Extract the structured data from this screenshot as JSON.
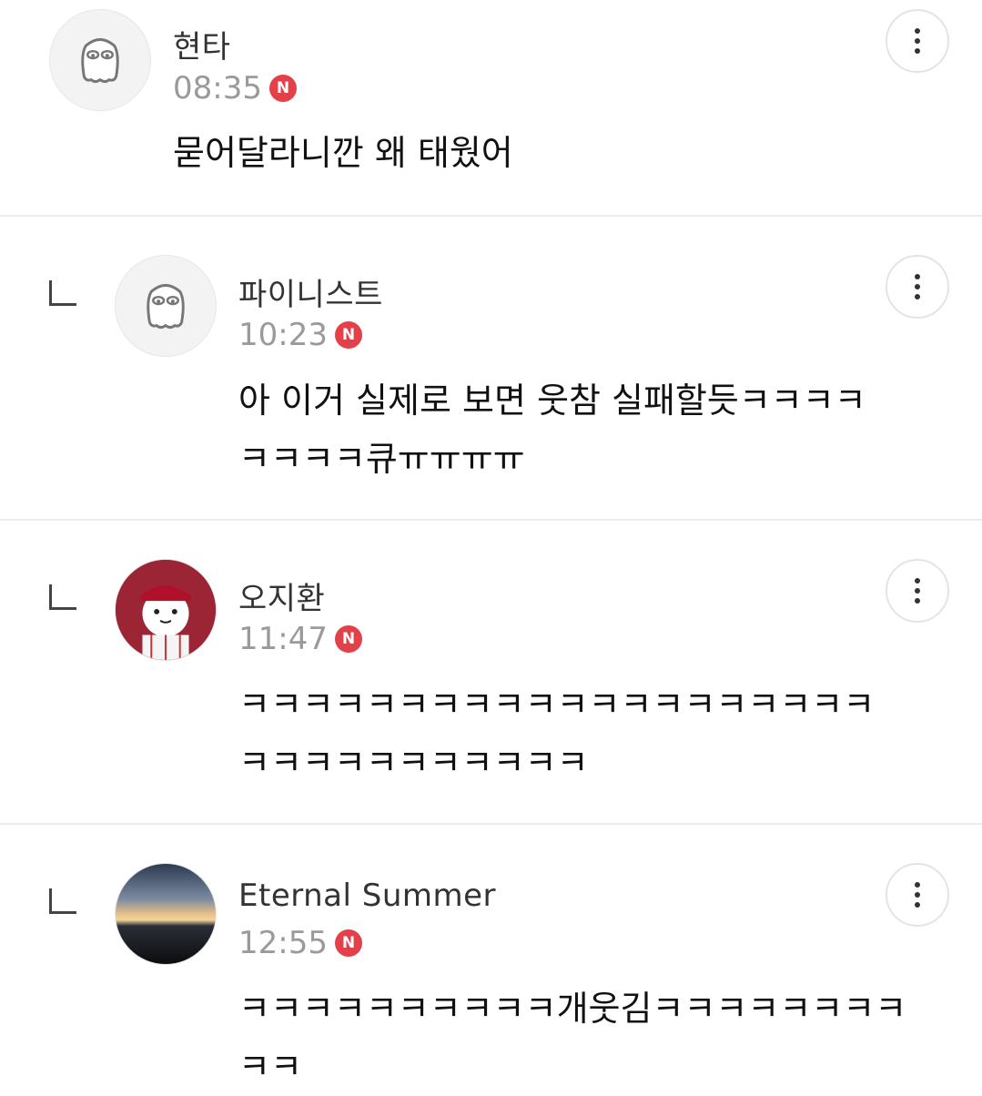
{
  "comments": [
    {
      "author": "현타",
      "time": "08:35",
      "badge": "N",
      "text": "묻어달라니깐 왜 태웠어",
      "avatar": "ghost-avatar",
      "reply": false
    },
    {
      "author": "파이니스트",
      "time": "10:23",
      "badge": "N",
      "text": "아 이거 실제로 보면 웃참 실패할듯ㅋㅋㅋㅋㅋㅋㅋㅋ큐ㅠㅠㅠㅠ",
      "avatar": "ghost-avatar",
      "reply": true
    },
    {
      "author": "오지환",
      "time": "11:47",
      "badge": "N",
      "text": "ㅋㅋㅋㅋㅋㅋㅋㅋㅋㅋㅋㅋㅋㅋㅋㅋㅋㅋㅋㅋㅋㅋㅋㅋㅋㅋㅋㅋㅋㅋㅋ",
      "avatar": "twins-cat-avatar",
      "reply": true
    },
    {
      "author": "Eternal Summer",
      "time": "12:55",
      "badge": "N",
      "text": "ㅋㅋㅋㅋㅋㅋㅋㅋㅋㅋ개웃김ㅋㅋㅋㅋㅋㅋㅋㅋㅋㅋ",
      "avatar": "sunset-avatar",
      "reply": true
    }
  ],
  "colors": {
    "badge": "#e3404a",
    "divider": "#ececec",
    "time": "#9a9a9a"
  }
}
